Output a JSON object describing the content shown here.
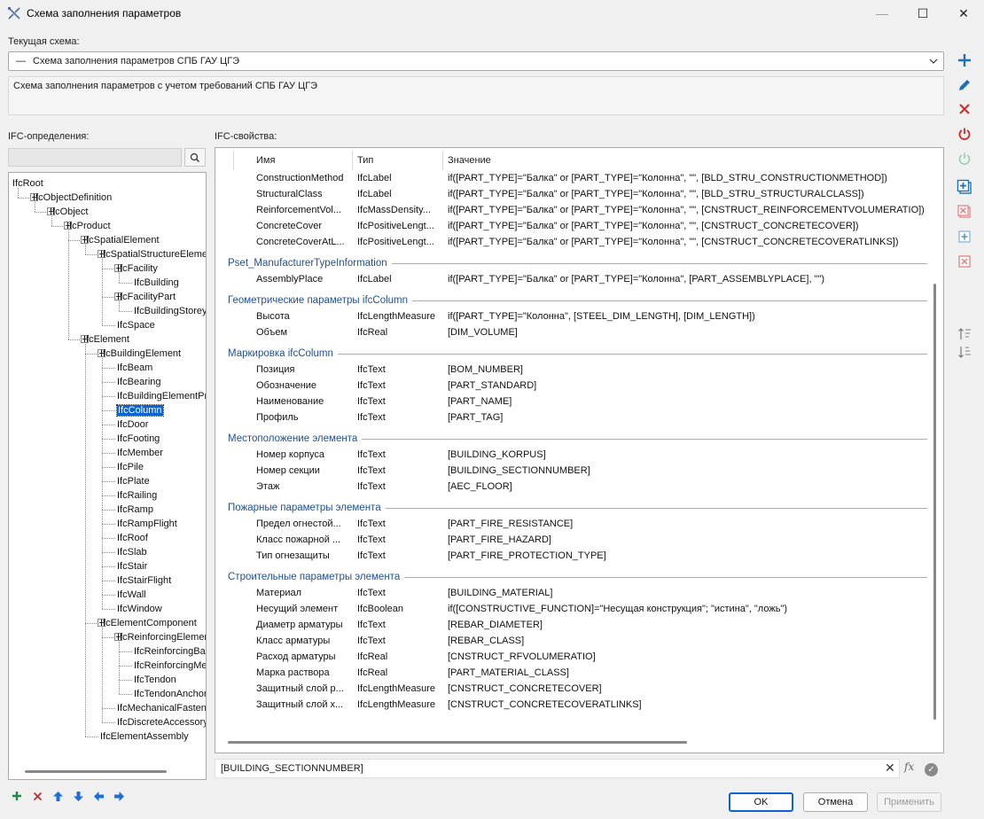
{
  "window": {
    "title": "Схема заполнения параметров",
    "minimize": "—",
    "maximize": "☐",
    "close": "✕"
  },
  "scheme": {
    "label": "Текущая схема:",
    "selected": "Схема заполнения параметров СПБ ГАУ ЦГЭ",
    "dash": "—",
    "description": "Схема заполнения параметров с учетом требований СПБ ГАУ ЦГЭ"
  },
  "left": {
    "label": "IFC-определения:",
    "search_value": "",
    "tree": [
      {
        "text": "IfcRoot",
        "level": 0,
        "box": false
      },
      {
        "text": "IfcObjectDefinition",
        "level": 1,
        "box": true
      },
      {
        "text": "IfcObject",
        "level": 2,
        "box": true
      },
      {
        "text": "IfcProduct",
        "level": 3,
        "box": true
      },
      {
        "text": "IfcSpatialElement",
        "level": 4,
        "box": true
      },
      {
        "text": "IfcSpatialStructureElement",
        "level": 5,
        "box": true
      },
      {
        "text": "IfcFacility",
        "level": 6,
        "box": true
      },
      {
        "text": "IfcBuilding",
        "level": 7,
        "box": false
      },
      {
        "text": "IfcFacilityPart",
        "level": 6,
        "box": true
      },
      {
        "text": "IfcBuildingStorey",
        "level": 7,
        "box": false
      },
      {
        "text": "IfcSpace",
        "level": 6,
        "box": false
      },
      {
        "text": "IfcElement",
        "level": 4,
        "box": true
      },
      {
        "text": "IfcBuildingElement",
        "level": 5,
        "box": true
      },
      {
        "text": "IfcBeam",
        "level": 6,
        "box": false
      },
      {
        "text": "IfcBearing",
        "level": 6,
        "box": false
      },
      {
        "text": "IfcBuildingElementProxy",
        "level": 6,
        "box": false
      },
      {
        "text": "IfcColumn",
        "level": 6,
        "box": false,
        "selected": true
      },
      {
        "text": "IfcDoor",
        "level": 6,
        "box": false
      },
      {
        "text": "IfcFooting",
        "level": 6,
        "box": false
      },
      {
        "text": "IfcMember",
        "level": 6,
        "box": false
      },
      {
        "text": "IfcPile",
        "level": 6,
        "box": false
      },
      {
        "text": "IfcPlate",
        "level": 6,
        "box": false
      },
      {
        "text": "IfcRailing",
        "level": 6,
        "box": false
      },
      {
        "text": "IfcRamp",
        "level": 6,
        "box": false
      },
      {
        "text": "IfcRampFlight",
        "level": 6,
        "box": false
      },
      {
        "text": "IfcRoof",
        "level": 6,
        "box": false
      },
      {
        "text": "IfcSlab",
        "level": 6,
        "box": false
      },
      {
        "text": "IfcStair",
        "level": 6,
        "box": false
      },
      {
        "text": "IfcStairFlight",
        "level": 6,
        "box": false
      },
      {
        "text": "IfcWall",
        "level": 6,
        "box": false
      },
      {
        "text": "IfcWindow",
        "level": 6,
        "box": false
      },
      {
        "text": "IfcElementComponent",
        "level": 5,
        "box": true
      },
      {
        "text": "IfcReinforcingElement",
        "level": 6,
        "box": true
      },
      {
        "text": "IfcReinforcingBar",
        "level": 7,
        "box": false
      },
      {
        "text": "IfcReinforcingMesh",
        "level": 7,
        "box": false
      },
      {
        "text": "IfcTendon",
        "level": 7,
        "box": false
      },
      {
        "text": "IfcTendonAnchor",
        "level": 7,
        "box": false
      },
      {
        "text": "IfcMechanicalFastener",
        "level": 6,
        "box": false
      },
      {
        "text": "IfcDiscreteAccessory",
        "level": 6,
        "box": false
      },
      {
        "text": "IfcElementAssembly",
        "level": 5,
        "box": false
      }
    ]
  },
  "right": {
    "label": "IFC-свойства:",
    "columns": {
      "name": "Имя",
      "type": "Тип",
      "value": "Значение"
    },
    "top_rows": [
      {
        "name": "ConstructionMethod",
        "type": "IfcLabel",
        "value": "if([PART_TYPE]=\"Балка\" or [PART_TYPE]=\"Колонна\", \"\", [BLD_STRU_CONSTRUCTIONMETHOD])"
      },
      {
        "name": "StructuralClass",
        "type": "IfcLabel",
        "value": "if([PART_TYPE]=\"Балка\" or [PART_TYPE]=\"Колонна\", \"\", [BLD_STRU_STRUCTURALCLASS])"
      },
      {
        "name": "ReinforcementVol...",
        "type": "IfcMassDensity...",
        "value": "if([PART_TYPE]=\"Балка\" or [PART_TYPE]=\"Колонна\", \"\", [CNSTRUCT_REINFORCEMENTVOLUMERATIO])"
      },
      {
        "name": "ConcreteCover",
        "type": "IfcPositiveLengt...",
        "value": "if([PART_TYPE]=\"Балка\" or [PART_TYPE]=\"Колонна\", \"\", [CNSTRUCT_CONCRETECOVER])"
      },
      {
        "name": "ConcreteCoverAtL...",
        "type": "IfcPositiveLengt...",
        "value": "if([PART_TYPE]=\"Балка\" or [PART_TYPE]=\"Колонна\", \"\", [CNSTRUCT_CONCRETECOVERATLINKS])"
      }
    ],
    "groups": [
      {
        "title": "Pset_ManufacturerTypeInformation",
        "rows": [
          {
            "name": "AssemblyPlace",
            "type": "IfcLabel",
            "value": "if([PART_TYPE]=\"Балка\" or [PART_TYPE]=\"Колонна\", [PART_ASSEMBLYPLACE], \"\")"
          }
        ]
      },
      {
        "title": "Геометрические параметры ifcColumn",
        "rows": [
          {
            "name": "Высота",
            "type": "IfcLengthMeasure",
            "value": "if([PART_TYPE]=\"Колонна\", [STEEL_DIM_LENGTH], [DIM_LENGTH])"
          },
          {
            "name": "Объем",
            "type": "IfcReal",
            "value": "[DIM_VOLUME]"
          }
        ]
      },
      {
        "title": "Маркировка ifcColumn",
        "rows": [
          {
            "name": "Позиция",
            "type": "IfcText",
            "value": "[BOM_NUMBER]"
          },
          {
            "name": "Обозначение",
            "type": "IfcText",
            "value": "[PART_STANDARD]"
          },
          {
            "name": "Наименование",
            "type": "IfcText",
            "value": "[PART_NAME]"
          },
          {
            "name": "Профиль",
            "type": "IfcText",
            "value": "[PART_TAG]"
          }
        ]
      },
      {
        "title": "Местоположение элемента",
        "rows": [
          {
            "name": "Номер корпуса",
            "type": "IfcText",
            "value": "[BUILDING_KORPUS]"
          },
          {
            "name": "Номер секции",
            "type": "IfcText",
            "value": "[BUILDING_SECTIONNUMBER]"
          },
          {
            "name": "Этаж",
            "type": "IfcText",
            "value": "[AEC_FLOOR]"
          }
        ]
      },
      {
        "title": "Пожарные параметры элемента",
        "rows": [
          {
            "name": "Предел огнестой...",
            "type": "IfcText",
            "value": "[PART_FIRE_RESISTANCE]"
          },
          {
            "name": "Класс пожарной ...",
            "type": "IfcText",
            "value": "[PART_FIRE_HAZARD]"
          },
          {
            "name": "Тип огнезащиты",
            "type": "IfcText",
            "value": "[PART_FIRE_PROTECTION_TYPE]"
          }
        ]
      },
      {
        "title": "Строительные параметры элемента",
        "rows": [
          {
            "name": "Материал",
            "type": "IfcText",
            "value": "[BUILDING_MATERIAL]"
          },
          {
            "name": "Несущий элемент",
            "type": "IfcBoolean",
            "value": "if([CONSTRUCTIVE_FUNCTION]=\"Несущая конструкция\"; \"истина\", \"ложь\")"
          },
          {
            "name": "Диаметр арматуры",
            "type": "IfcText",
            "value": "[REBAR_DIAMETER]"
          },
          {
            "name": "Класс арматуры",
            "type": "IfcText",
            "value": "[REBAR_CLASS]"
          },
          {
            "name": "Расход арматуры",
            "type": "IfcReal",
            "value": "[CNSTRUCT_RFVOLUMERATIO]"
          },
          {
            "name": "Марка раствора",
            "type": "IfcReal",
            "value": "[PART_MATERIAL_CLASS]"
          },
          {
            "name": "Защитный слой р...",
            "type": "IfcLengthMeasure",
            "value": "[CNSTRUCT_CONCRETECOVER]"
          },
          {
            "name": "Защитный слой х...",
            "type": "IfcLengthMeasure",
            "value": "[CNSTRUCT_CONCRETECOVERATLINKS]"
          }
        ]
      }
    ],
    "value_editor": "[BUILDING_SECTIONNUMBER]",
    "fx": "fx"
  },
  "buttons": {
    "ok": "OK",
    "cancel": "Отмена",
    "apply": "Применить"
  },
  "colors": {
    "accent": "#0a64d8",
    "group_title": "#1f4f97",
    "add": "#1e8a4a",
    "delete": "#d32424"
  }
}
